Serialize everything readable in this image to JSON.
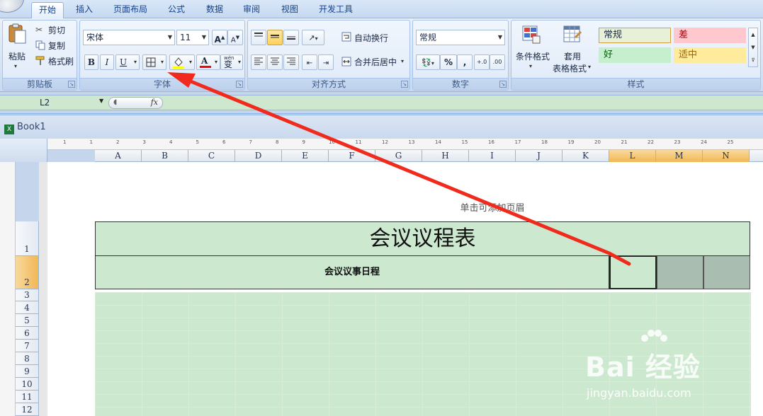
{
  "tabs": [
    "开始",
    "插入",
    "页面布局",
    "公式",
    "数据",
    "审阅",
    "视图",
    "开发工具"
  ],
  "clipboard": {
    "paste": "粘贴",
    "cut": "剪切",
    "copy": "复制",
    "format_painter": "格式刷",
    "label": "剪贴板"
  },
  "font": {
    "name": "宋体",
    "size": "11",
    "bold": "B",
    "italic": "I",
    "underline": "U",
    "phonetic": "wén",
    "phonetic_char": "变",
    "grow": "A",
    "shrink": "A",
    "label": "字体"
  },
  "alignment": {
    "wrap": "自动换行",
    "merge": "合并后居中",
    "label": "对齐方式"
  },
  "number": {
    "format": "常规",
    "percent": "%",
    "comma": ",",
    "label": "数字"
  },
  "styles": {
    "conditional": "条件格式",
    "table_line1": "套用",
    "table_line2": "表格格式",
    "normal": "常规",
    "bad": "差",
    "good": "好",
    "neutral": "适中",
    "label": "样式"
  },
  "formula_bar": {
    "cell_ref": "L2",
    "fx": "fx"
  },
  "workbook": {
    "title": "Book1"
  },
  "columns": [
    "A",
    "B",
    "C",
    "D",
    "E",
    "F",
    "G",
    "H",
    "I",
    "J",
    "K",
    "L",
    "M",
    "N"
  ],
  "selected_columns": [
    "L",
    "M",
    "N"
  ],
  "ruler_numbers": [
    "1",
    "1",
    "2",
    "3",
    "4",
    "5",
    "6",
    "7",
    "8",
    "9",
    "10",
    "11",
    "12",
    "13",
    "14",
    "15",
    "16",
    "17",
    "18",
    "19",
    "20",
    "21",
    "22",
    "23",
    "24",
    "25"
  ],
  "rows": [
    "1",
    "2",
    "3",
    "4",
    "5",
    "6",
    "7",
    "8",
    "9",
    "10",
    "11",
    "12"
  ],
  "sheet": {
    "header_hint": "单击可添加页眉",
    "title": "会议议程表",
    "subtitle": "会议议事日程"
  },
  "watermark": {
    "logo": "Bai 经验",
    "url": "jingyan.baidu.com"
  },
  "colors": {
    "accent_arrow": "#f02a1c",
    "sheet_bg": "#cce8cf",
    "selection": "#a9bdb1",
    "bad_bg": "#ffc7ce",
    "good_bg": "#c6efce",
    "neutral_bg": "#ffeb9c"
  }
}
